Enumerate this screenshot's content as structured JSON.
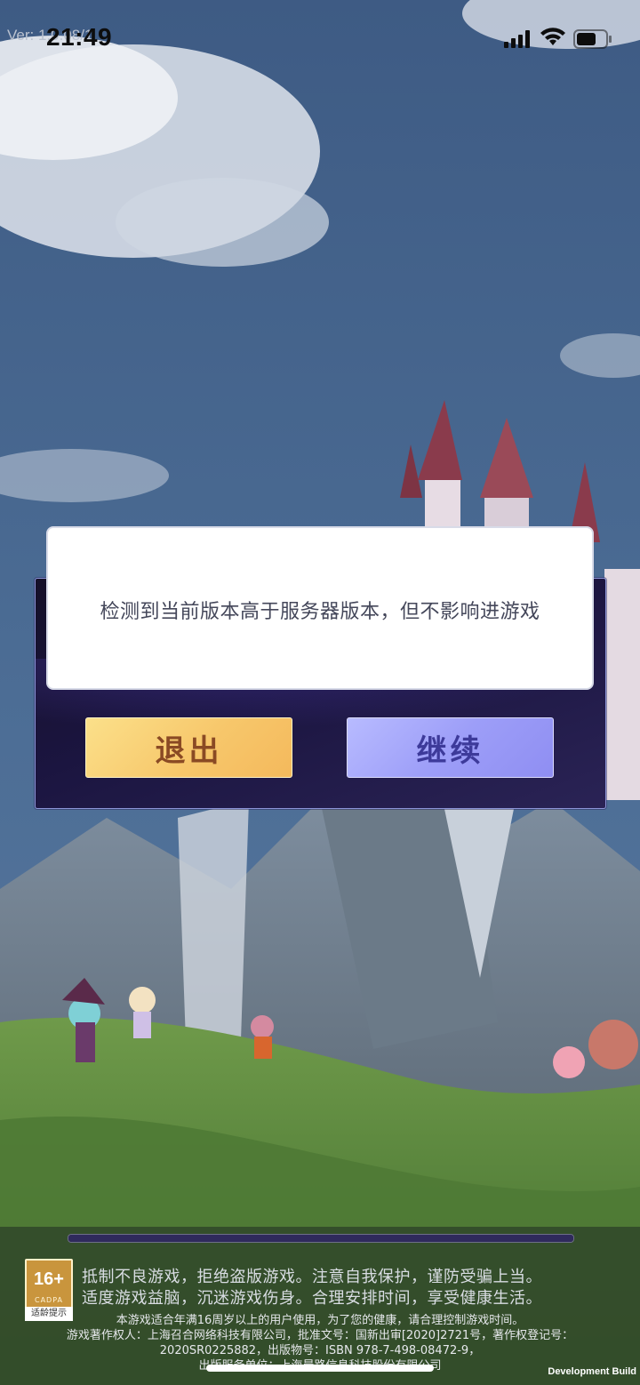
{
  "status_bar": {
    "version_text": "Ver: 1.0.08/1",
    "time": "21:49"
  },
  "dialog": {
    "message": "检测到当前版本高于服务器版本，但不影响进游戏",
    "exit_label": "退出",
    "continue_label": "继续"
  },
  "loading": {
    "progress": 1.0
  },
  "footer": {
    "age_rating": "16+",
    "age_rating_org": "CADPA",
    "age_tip": "适龄提示",
    "notice_line_1": "抵制不良游戏，拒绝盗版游戏。注意自我保护，谨防受骗上当。",
    "notice_line_2": "适度游戏益脑，沉迷游戏伤身。合理安排时间，享受健康生活。",
    "legal_line_1": "本游戏适合年满16周岁以上的用户使用，为了您的健康，请合理控制游戏时间。",
    "legal_line_2": "游戏著作权人：上海召合网络科技有限公司，批准文号：国新出审[2020]2721号，著作权登记号：",
    "legal_line_3": "2020SR0225882，出版物号：ISBN 978-7-498-08472-9，",
    "legal_line_4": "出版服务单位：上海晨路信息科技股份有限公司"
  },
  "dev_build_label": "Development Build",
  "colors": {
    "exit_button": "#f7c76b",
    "continue_button": "#9d9ef8",
    "dialog_frame": "#1b1540"
  }
}
